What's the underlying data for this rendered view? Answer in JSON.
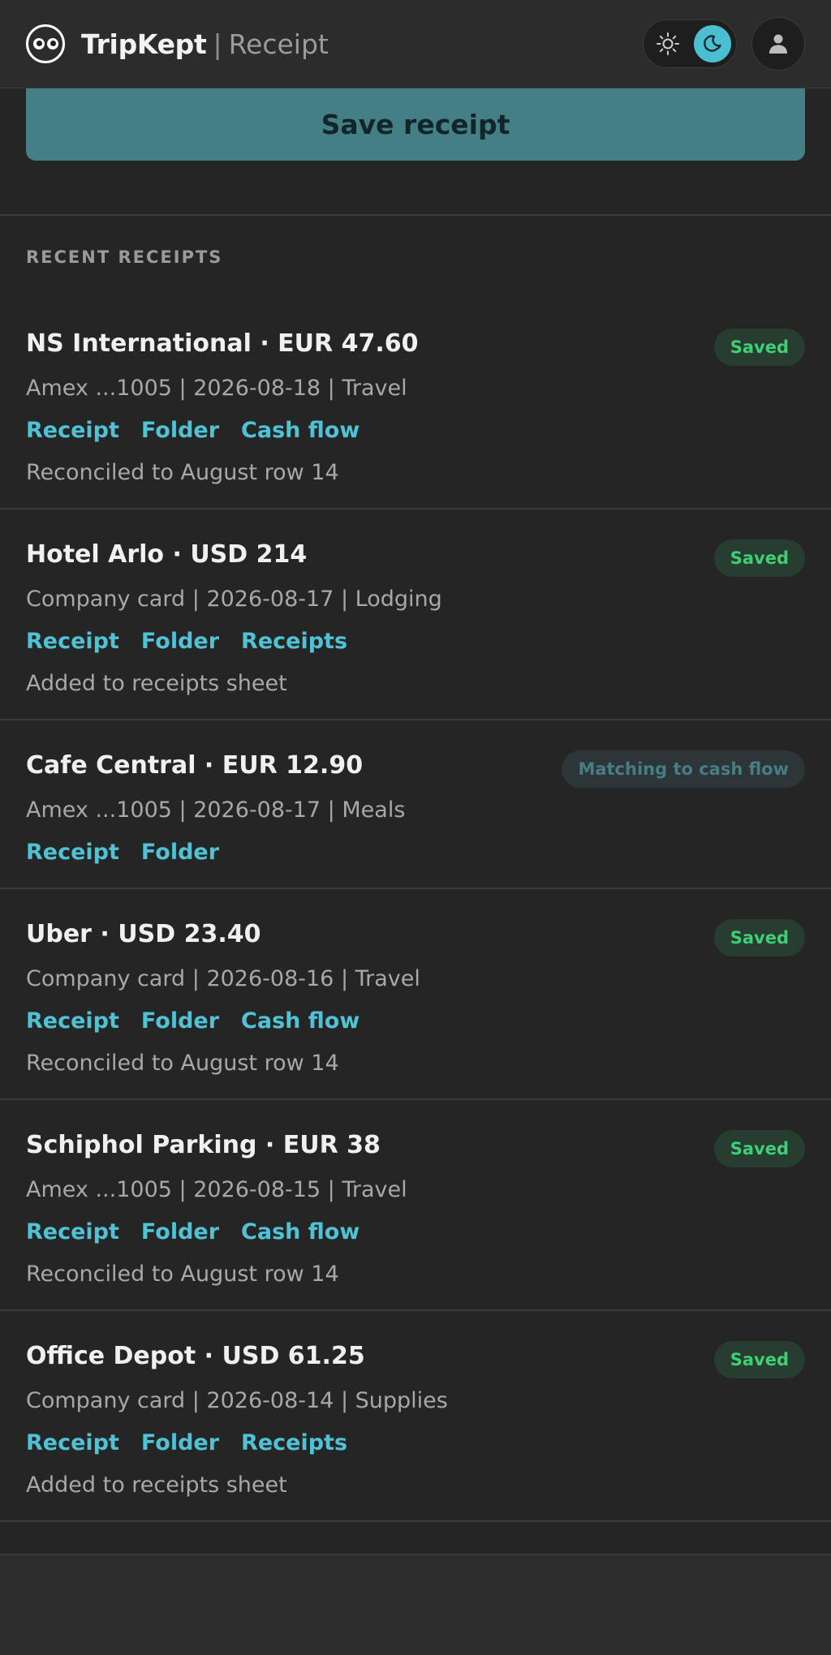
{
  "header": {
    "brand": "TripKept",
    "separator": "|",
    "subtitle": "Receipt",
    "logo_icon": "eyes-logo-icon",
    "theme_light_icon": "sun-icon",
    "theme_dark_icon": "moon-icon",
    "theme_active": "dark",
    "avatar_icon": "user-icon"
  },
  "actions": {
    "save_label": "Save receipt"
  },
  "recent": {
    "title": "RECENT RECEIPTS",
    "items": [
      {
        "title": "NS International · EUR 47.60",
        "meta": "Amex ...1005 | 2026-08-18 | Travel",
        "links": [
          "Receipt",
          "Folder",
          "Cash flow"
        ],
        "note": "Reconciled to August row 14",
        "status": "Saved"
      },
      {
        "title": "Hotel Arlo · USD 214",
        "meta": "Company card | 2026-08-17 | Lodging",
        "links": [
          "Receipt",
          "Folder",
          "Receipts"
        ],
        "note": "Added to receipts sheet",
        "status": "Saved"
      },
      {
        "title": "Cafe Central · EUR 12.90",
        "meta": "Amex ...1005 | 2026-08-17 | Meals",
        "links": [
          "Receipt",
          "Folder"
        ],
        "note": "",
        "status": "Matching to cash flow"
      },
      {
        "title": "Uber · USD 23.40",
        "meta": "Company card | 2026-08-16 | Travel",
        "links": [
          "Receipt",
          "Folder",
          "Cash flow"
        ],
        "note": "Reconciled to August row 14",
        "status": "Saved"
      },
      {
        "title": "Schiphol Parking · EUR 38",
        "meta": "Amex ...1005 | 2026-08-15 | Travel",
        "links": [
          "Receipt",
          "Folder",
          "Cash flow"
        ],
        "note": "Reconciled to August row 14",
        "status": "Saved"
      },
      {
        "title": "Office Depot · USD 61.25",
        "meta": "Company card | 2026-08-14 | Supplies",
        "links": [
          "Receipt",
          "Folder",
          "Receipts"
        ],
        "note": "Added to receipts sheet",
        "status": "Saved"
      }
    ]
  },
  "colors": {
    "accent": "#4fc2d6",
    "saved_badge_text": "#3ecf77",
    "matching_badge_text": "#477d87",
    "save_button": "#447f87"
  }
}
